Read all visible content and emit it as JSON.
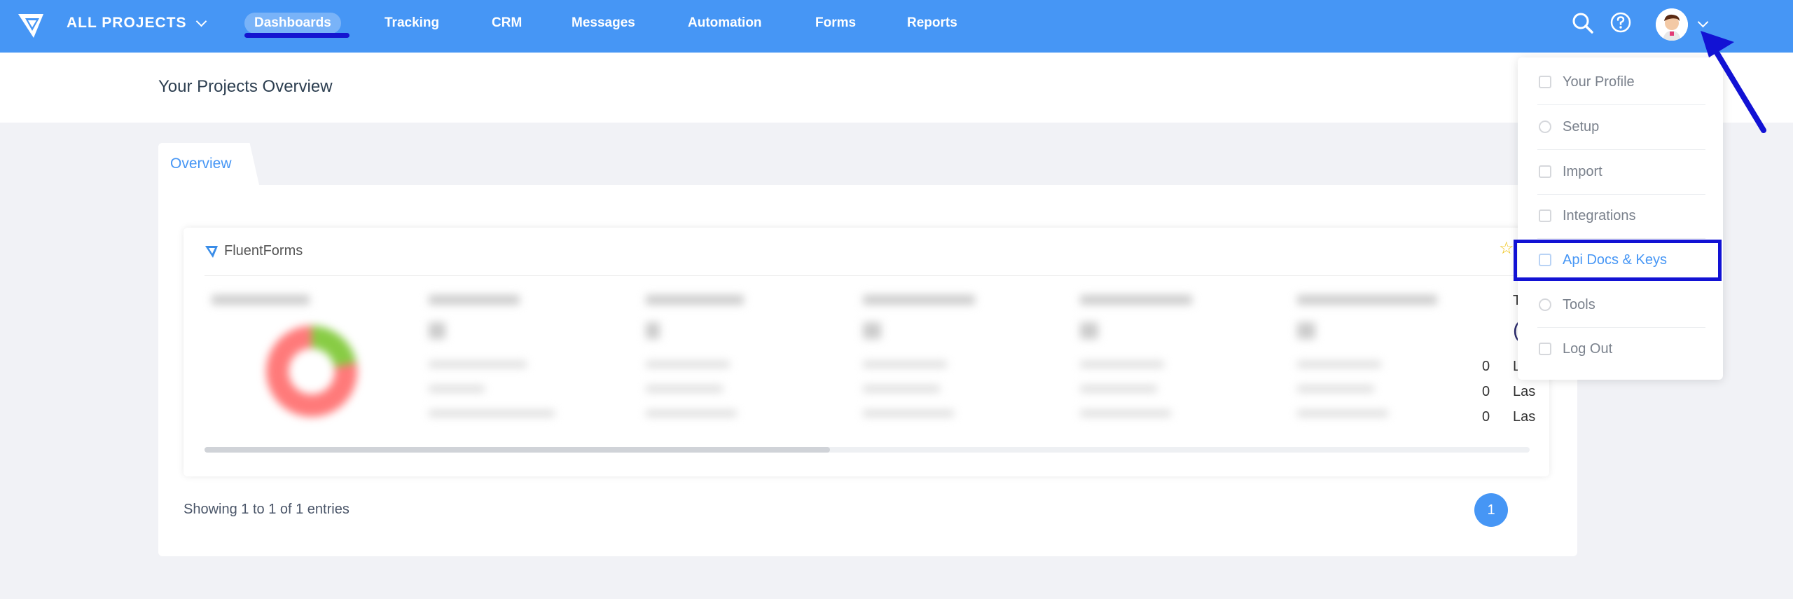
{
  "topbar": {
    "project_selector": "ALL PROJECTS",
    "nav": [
      {
        "label": "Dashboards",
        "active": true
      },
      {
        "label": "Tracking"
      },
      {
        "label": "CRM"
      },
      {
        "label": "Messages"
      },
      {
        "label": "Automation"
      },
      {
        "label": "Forms"
      },
      {
        "label": "Reports"
      }
    ],
    "icons": [
      "search-icon",
      "help-icon",
      "avatar",
      "chevron-down-icon"
    ]
  },
  "header": {
    "title": "Your Projects Overview"
  },
  "tabs": [
    {
      "label": "Overview",
      "active": true
    }
  ],
  "widget": {
    "title": "FluentForms",
    "zero_values": [
      "0",
      "0",
      "0"
    ],
    "truncated_labels": [
      "T",
      "(",
      "L",
      "Las",
      "Las"
    ]
  },
  "pagination": {
    "summary": "Showing 1 to 1 of 1 entries",
    "current_page": "1"
  },
  "dropdown": {
    "items": [
      {
        "label": "Your Profile",
        "icon": "profile-icon"
      },
      {
        "label": "Setup",
        "icon": "gear-icon"
      },
      {
        "label": "Import",
        "icon": "import-icon"
      },
      {
        "label": "Integrations",
        "icon": "integrations-icon"
      },
      {
        "label": "Api Docs & Keys",
        "icon": "api-icon",
        "highlighted": true
      },
      {
        "label": "Tools",
        "icon": "tools-icon"
      },
      {
        "label": "Log Out",
        "icon": "logout-icon"
      }
    ]
  },
  "colors": {
    "primary": "#4696f5",
    "annotation": "#1212d4"
  }
}
